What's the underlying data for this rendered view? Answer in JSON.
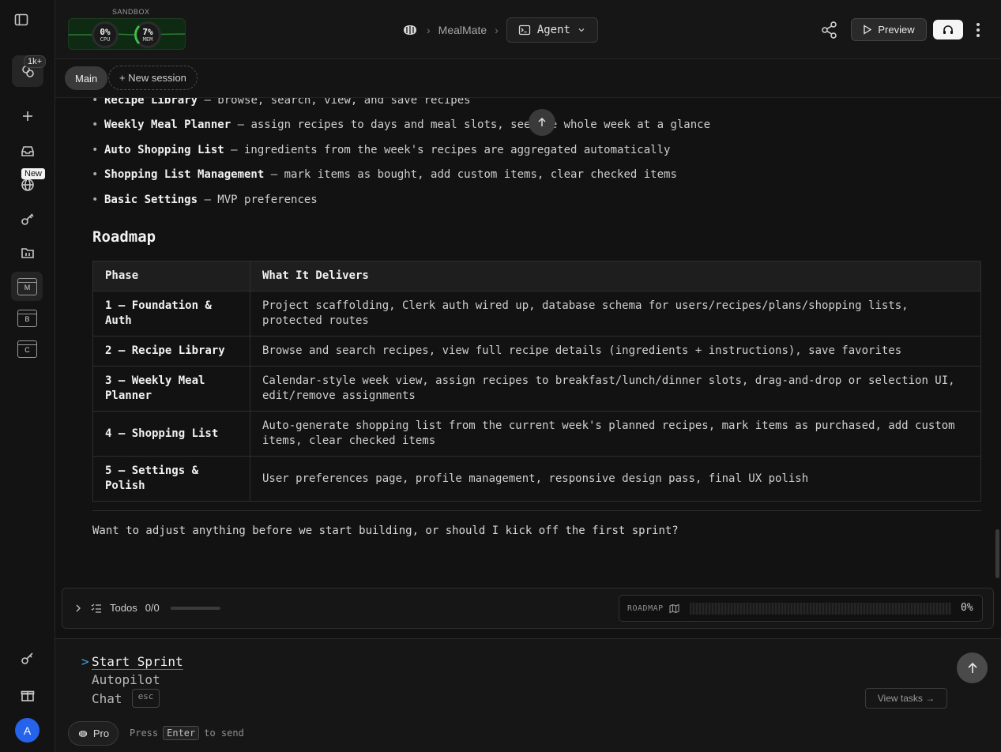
{
  "sidebar": {
    "notifications_badge": "1k+",
    "new_tag": "New",
    "projects": [
      "M",
      "B",
      "C"
    ],
    "avatar_initial": "A"
  },
  "topbar": {
    "sandbox_label": "SANDBOX",
    "cpu": {
      "value": "0%",
      "label": "CPU"
    },
    "mem": {
      "value": "7%",
      "label": "MEM"
    },
    "breadcrumb_project": "MealMate",
    "agent_label": "Agent",
    "preview_label": "Preview"
  },
  "sessions": {
    "main_label": "Main",
    "new_label": "+ New session"
  },
  "features": [
    {
      "title": "Recipe Library",
      "desc": " — browse, search, view, and save recipes"
    },
    {
      "title": "Weekly Meal Planner",
      "desc": " — assign recipes to days and meal slots, see the whole week at a glance"
    },
    {
      "title": "Auto Shopping List",
      "desc": " — ingredients from the week's recipes are aggregated automatically"
    },
    {
      "title": "Shopping List Management",
      "desc": " — mark items as bought, add custom items, clear checked items"
    },
    {
      "title": "Basic Settings",
      "desc": " — MVP preferences"
    }
  ],
  "roadmap": {
    "heading": "Roadmap",
    "columns": [
      "Phase",
      "What It Delivers"
    ],
    "rows": [
      [
        "1 — Foundation & Auth",
        "Project scaffolding, Clerk auth wired up, database schema for users/recipes/plans/shopping lists, protected routes"
      ],
      [
        "2 — Recipe Library",
        "Browse and search recipes, view full recipe details (ingredients + instructions), save favorites"
      ],
      [
        "3 — Weekly Meal Planner",
        "Calendar-style week view, assign recipes to breakfast/lunch/dinner slots, drag-and-drop or selection UI, edit/remove assignments"
      ],
      [
        "4 — Shopping List",
        "Auto-generate shopping list from the current week's planned recipes, mark items as purchased, add custom items, clear checked items"
      ],
      [
        "5 — Settings & Polish",
        "User preferences page, profile management, responsive design pass, final UX polish"
      ]
    ]
  },
  "question": "Want to adjust anything before we start building, or should I kick off the first sprint?",
  "todos": {
    "label": "Todos",
    "count": "0/0",
    "roadmap_label": "ROADMAP",
    "roadmap_progress": "0%"
  },
  "composer": {
    "caret": ">",
    "options": [
      "Start Sprint",
      "Autopilot",
      "Chat"
    ],
    "esc_label": "esc",
    "view_tasks_label": "View tasks →",
    "pro_label": "Pro",
    "hint_press": "Press",
    "hint_key": "Enter",
    "hint_tail": "to send"
  }
}
